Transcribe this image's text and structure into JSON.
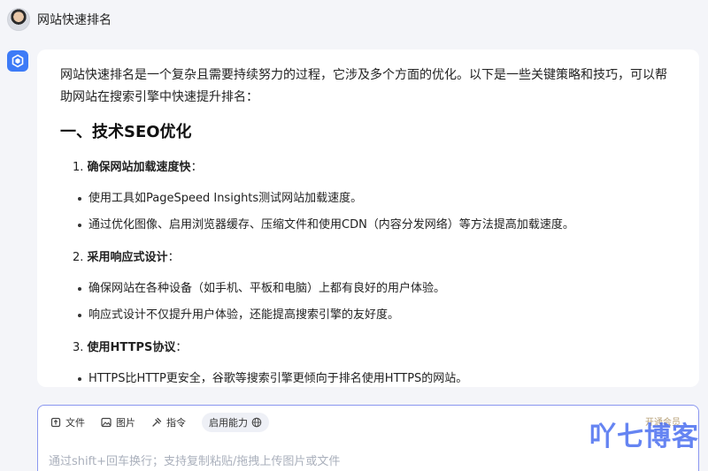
{
  "user": {
    "message": "网站快速排名"
  },
  "answer": {
    "intro": "网站快速排名是一个复杂且需要持续努力的过程，它涉及多个方面的优化。以下是一些关键策略和技巧，可以帮助网站在搜索引擎中快速提升排名：",
    "section_title": "一、技术SEO优化",
    "items": [
      {
        "number": "1.",
        "title": "确保网站加载速度快",
        "colon": "：",
        "bullets": [
          "使用工具如PageSpeed Insights测试网站加载速度。",
          "通过优化图像、启用浏览器缓存、压缩文件和使用CDN（内容分发网络）等方法提高加载速度。"
        ]
      },
      {
        "number": "2.",
        "title": "采用响应式设计",
        "colon": "：",
        "bullets": [
          "确保网站在各种设备（如手机、平板和电脑）上都有良好的用户体验。",
          "响应式设计不仅提升用户体验，还能提高搜索引擎的友好度。"
        ]
      },
      {
        "number": "3.",
        "title": "使用HTTPS协议",
        "colon": "：",
        "bullets": [
          "HTTPS比HTTP更安全，谷歌等搜索引擎更倾向于排名使用HTTPS的网站。"
        ]
      }
    ]
  },
  "input": {
    "tools": {
      "file": "文件",
      "image": "图片",
      "command": "指令",
      "capability": "启用能力"
    },
    "placeholder": "通过shift+回车换行；支持复制粘贴/拖拽上传图片或文件",
    "member": "开通会员"
  },
  "watermark": "吖七博客",
  "colors": {
    "accent": "#3d7bf7",
    "input_border": "#8a97f0",
    "watermark": "#4b6ff0"
  }
}
